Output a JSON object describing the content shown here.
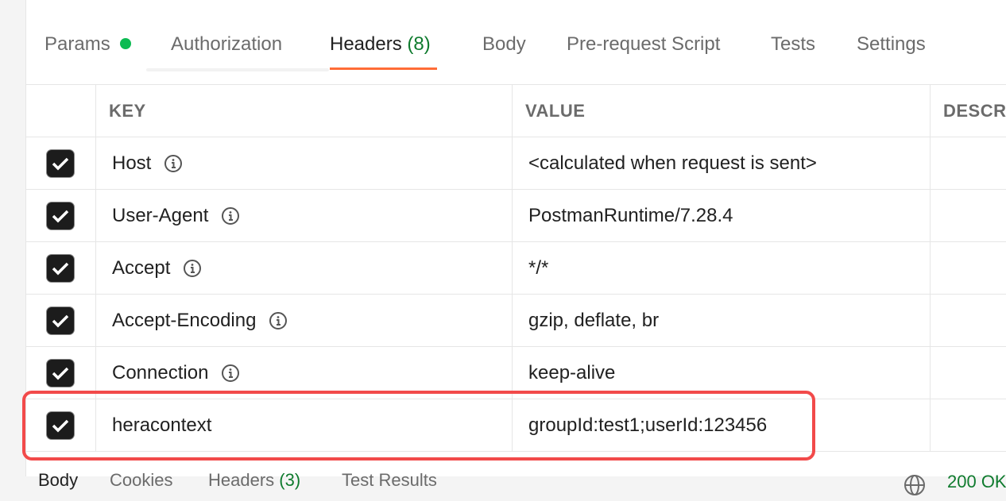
{
  "tabs": [
    {
      "label": "Params",
      "has_dot": true
    },
    {
      "label": "Authorization"
    },
    {
      "label": "Headers",
      "count": "(8)",
      "active": true
    },
    {
      "label": "Body"
    },
    {
      "label": "Pre-request Script"
    },
    {
      "label": "Tests"
    },
    {
      "label": "Settings"
    }
  ],
  "table": {
    "headers": {
      "key": "KEY",
      "value": "VALUE",
      "description": "DESCR"
    },
    "rows": [
      {
        "key": "Host",
        "value": "<calculated when request is sent>",
        "checked": true,
        "info": true
      },
      {
        "key": "User-Agent",
        "value": "PostmanRuntime/7.28.4",
        "checked": true,
        "info": true
      },
      {
        "key": "Accept",
        "value": "*/*",
        "checked": true,
        "info": true
      },
      {
        "key": "Accept-Encoding",
        "value": "gzip, deflate, br",
        "checked": true,
        "info": true
      },
      {
        "key": "Connection",
        "value": "keep-alive",
        "checked": true,
        "info": true
      },
      {
        "key": "heracontext",
        "value": "groupId:test1;userId:123456",
        "checked": true,
        "info": false
      }
    ]
  },
  "response_tabs": [
    {
      "label": "Body",
      "active": true
    },
    {
      "label": "Cookies"
    },
    {
      "label": "Headers",
      "count": "(3)"
    },
    {
      "label": "Test Results"
    }
  ],
  "status": {
    "text": "200 OK"
  },
  "colors": {
    "accent": "#ff6c37",
    "highlight": "#f24a4a",
    "success": "#0cbb52"
  }
}
